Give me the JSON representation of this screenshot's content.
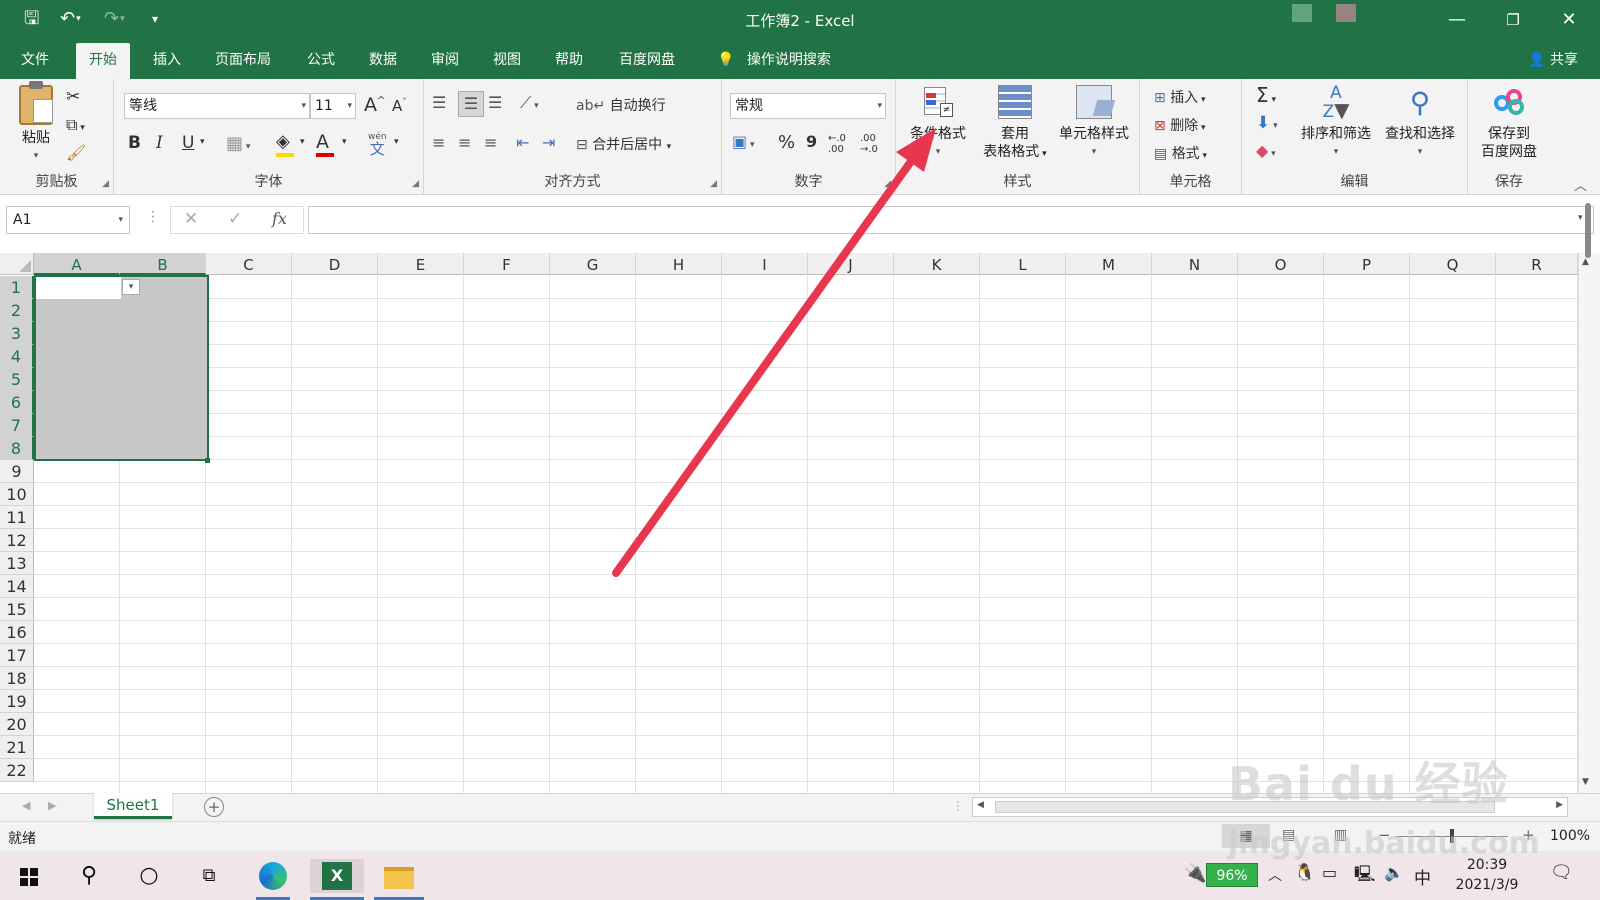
{
  "window": {
    "title": "工作簿2  -  Excel",
    "minimize": "—",
    "restore": "❐",
    "close": "✕"
  },
  "tabs": [
    {
      "label": "文件"
    },
    {
      "label": "开始"
    },
    {
      "label": "插入"
    },
    {
      "label": "页面布局"
    },
    {
      "label": "公式"
    },
    {
      "label": "数据"
    },
    {
      "label": "审阅"
    },
    {
      "label": "视图"
    },
    {
      "label": "帮助"
    },
    {
      "label": "百度网盘"
    }
  ],
  "tell_me": "操作说明搜索",
  "share": "共享",
  "ribbon": {
    "clipboard": {
      "label": "剪贴板",
      "paste": "粘贴"
    },
    "font": {
      "label": "字体",
      "font_name": "等线",
      "font_size": "11",
      "bold": "B",
      "italic": "I",
      "underline": "U",
      "grow": "A",
      "shrink": "A",
      "color_a": "A",
      "phonetic_top": "wén",
      "phonetic_bottom": "文"
    },
    "alignment": {
      "label": "对齐方式",
      "wrap": "自动换行",
      "merge": "合并后居中"
    },
    "number": {
      "label": "数字",
      "format": "常规",
      "percent": "%",
      "comma": "9",
      "inc_decimal": "←.0  .00",
      "dec_decimal": ".00  →.0"
    },
    "styles": {
      "label": "样式",
      "conditional": "条件格式",
      "table_l1": "套用",
      "table_l2": "表格格式",
      "cell_styles": "单元格样式"
    },
    "cells": {
      "label": "单元格",
      "insert": "插入",
      "delete": "删除",
      "format": "格式"
    },
    "editing": {
      "label": "编辑",
      "sort": "排序和筛选",
      "find": "查找和选择",
      "sigma": "Σ"
    },
    "save": {
      "label": "保存",
      "line1": "保存到",
      "line2": "百度网盘"
    }
  },
  "formula_bar": {
    "name_box": "A1",
    "fx": "fx",
    "cancel": "✕",
    "enter": "✓"
  },
  "columns": [
    "A",
    "B",
    "C",
    "D",
    "E",
    "F",
    "G",
    "H",
    "I",
    "J",
    "K",
    "L",
    "M",
    "N",
    "O",
    "P",
    "Q",
    "R"
  ],
  "rows": [
    "1",
    "2",
    "3",
    "4",
    "5",
    "6",
    "7",
    "8",
    "9",
    "10",
    "11",
    "12",
    "13",
    "14",
    "15",
    "16",
    "17",
    "18",
    "19",
    "20",
    "21",
    "22"
  ],
  "sheet": {
    "name": "Sheet1",
    "add": "+"
  },
  "status": {
    "ready": "就绪",
    "zoom": "100%"
  },
  "taskbar": {
    "battery": "96%",
    "ime": "中",
    "time": "20:39",
    "date": "2021/3/9"
  },
  "watermark": {
    "line1": "Bai du 经验",
    "line2": "jingyan.baidu.com"
  },
  "colors": {
    "excel_green": "#217346",
    "arrow": "#e8364e",
    "selection": "#c8c8c8"
  }
}
